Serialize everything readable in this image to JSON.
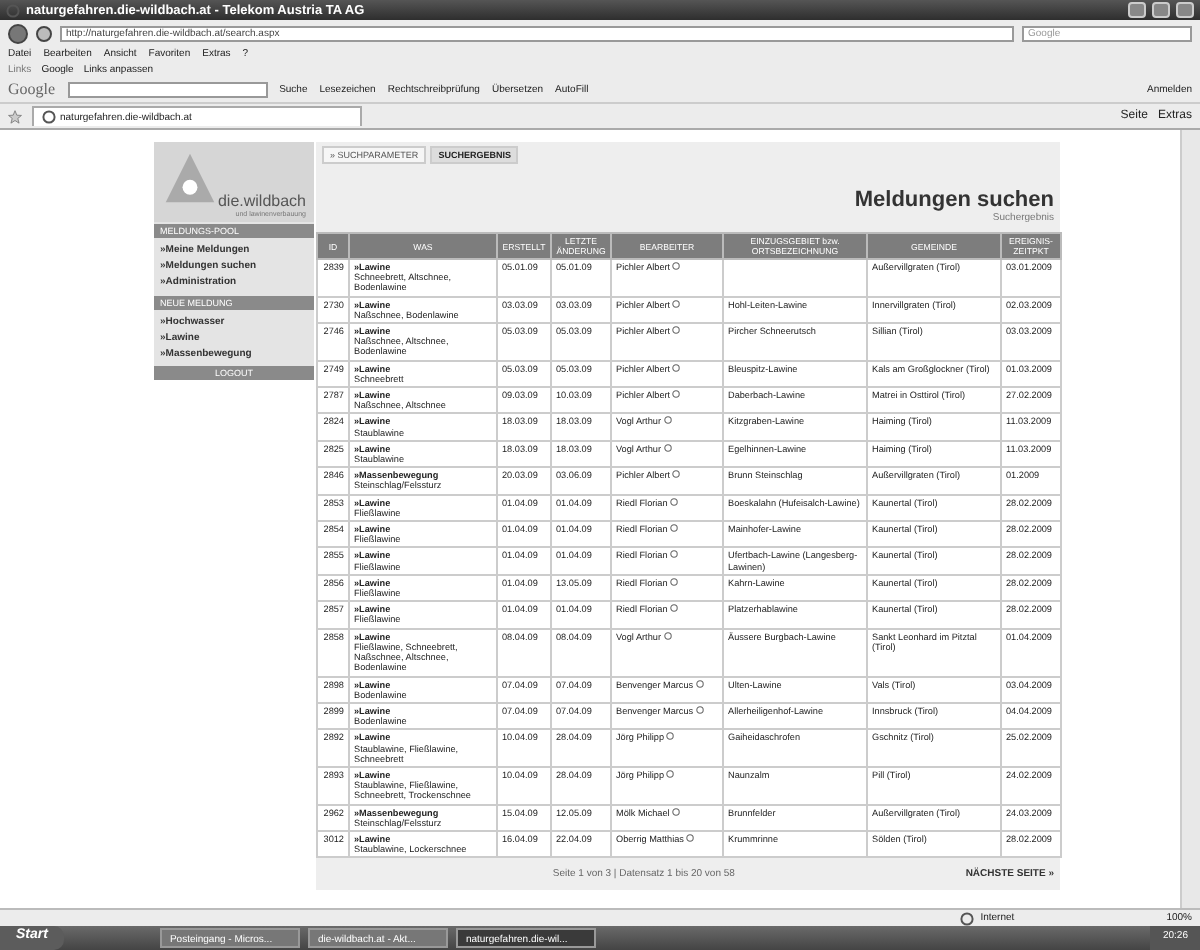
{
  "browser": {
    "title": "naturgefahren.die-wildbach.at - Telekom Austria TA AG",
    "address": "http://naturgefahren.die-wildbach.at/search.aspx",
    "search_placeholder": "Google",
    "menu": [
      "Datei",
      "Bearbeiten",
      "Ansicht",
      "Favoriten",
      "Extras",
      "?"
    ],
    "links_label": "Links",
    "links": [
      "Google",
      "Links anpassen"
    ],
    "google_toolbar": {
      "logo": "Google",
      "items": [
        "Suche",
        "Lesezeichen",
        "Rechtschreibprüfung",
        "Übersetzen",
        "AutoFill"
      ],
      "sign_in": "Anmelden"
    },
    "tab": {
      "title": "naturgefahren.die-wildbach.at"
    },
    "commands": [
      "Seite",
      "Extras"
    ]
  },
  "sidebar": {
    "logo": {
      "name": "die.wildbach",
      "tagline": "und lawinenverbauung"
    },
    "sections": [
      {
        "title": "MELDUNGS-POOL",
        "items": [
          "»Meine Meldungen",
          "»Meldungen suchen",
          "»Administration"
        ]
      },
      {
        "title": "NEUE MELDUNG",
        "items": [
          "»Hochwasser",
          "»Lawine",
          "»Massenbewegung"
        ]
      }
    ],
    "logout": "LOGOUT"
  },
  "page": {
    "tabs": [
      {
        "label": "» SUCHPARAMETER",
        "selected": false
      },
      {
        "label": "SUCHERGEBNIS",
        "selected": true
      }
    ],
    "title": "Meldungen suchen",
    "subtitle": "Suchergebnis",
    "table": {
      "columns": [
        "ID",
        "WAS",
        "ERSTELLT",
        "LETZTE ÄNDERUNG",
        "BEARBEITER",
        "EINZUGSGEBIET bzw. ORTSBEZEICHNUNG",
        "GEMEINDE",
        "EREIGNIS-ZEITPKT"
      ],
      "rows": [
        {
          "id": "2839",
          "category": "»Lawine",
          "types": "Schneebrett, Altschnee, Bodenlawine",
          "created": "05.01.09",
          "modified": "05.01.09",
          "editor": "Pichler Albert",
          "area": "",
          "municipality": "Außervillgraten (Tirol)",
          "event_date": "03.01.2009"
        },
        {
          "id": "2730",
          "category": "»Lawine",
          "types": "Naßschnee, Bodenlawine",
          "created": "03.03.09",
          "modified": "03.03.09",
          "editor": "Pichler Albert",
          "area": "Hohl-Leiten-Lawine",
          "municipality": "Innervillgraten (Tirol)",
          "event_date": "02.03.2009"
        },
        {
          "id": "2746",
          "category": "»Lawine",
          "types": "Naßschnee, Altschnee, Bodenlawine",
          "created": "05.03.09",
          "modified": "05.03.09",
          "editor": "Pichler Albert",
          "area": "Pircher Schneerutsch",
          "municipality": "Sillian (Tirol)",
          "event_date": "03.03.2009"
        },
        {
          "id": "2749",
          "category": "»Lawine",
          "types": "Schneebrett",
          "created": "05.03.09",
          "modified": "05.03.09",
          "editor": "Pichler Albert",
          "area": "Bleuspitz-Lawine",
          "municipality": "Kals am Großglockner (Tirol)",
          "event_date": "01.03.2009"
        },
        {
          "id": "2787",
          "category": "»Lawine",
          "types": "Naßschnee, Altschnee",
          "created": "09.03.09",
          "modified": "10.03.09",
          "editor": "Pichler Albert",
          "area": "Daberbach-Lawine",
          "municipality": "Matrei in Osttirol (Tirol)",
          "event_date": "27.02.2009"
        },
        {
          "id": "2824",
          "category": "»Lawine",
          "types": "Staublawine",
          "created": "18.03.09",
          "modified": "18.03.09",
          "editor": "Vogl Arthur",
          "area": "Kitzgraben-Lawine",
          "municipality": "Haiming (Tirol)",
          "event_date": "11.03.2009"
        },
        {
          "id": "2825",
          "category": "»Lawine",
          "types": "Staublawine",
          "created": "18.03.09",
          "modified": "18.03.09",
          "editor": "Vogl Arthur",
          "area": "Egelhinnen-Lawine",
          "municipality": "Haiming (Tirol)",
          "event_date": "11.03.2009"
        },
        {
          "id": "2846",
          "category": "»Massenbewegung",
          "types": "Steinschlag/Felssturz",
          "created": "20.03.09",
          "modified": "03.06.09",
          "editor": "Pichler Albert",
          "area": "Brunn Steinschlag",
          "municipality": "Außervillgraten (Tirol)",
          "event_date": "01.2009"
        },
        {
          "id": "2853",
          "category": "»Lawine",
          "types": "Fließlawine",
          "created": "01.04.09",
          "modified": "01.04.09",
          "editor": "Riedl Florian",
          "area": "Boeskalahn (Hufeisalch-Lawine)",
          "municipality": "Kaunertal (Tirol)",
          "event_date": "28.02.2009"
        },
        {
          "id": "2854",
          "category": "»Lawine",
          "types": "Fließlawine",
          "created": "01.04.09",
          "modified": "01.04.09",
          "editor": "Riedl Florian",
          "area": "Mainhofer-Lawine",
          "municipality": "Kaunertal (Tirol)",
          "event_date": "28.02.2009"
        },
        {
          "id": "2855",
          "category": "»Lawine",
          "types": "Fließlawine",
          "created": "01.04.09",
          "modified": "01.04.09",
          "editor": "Riedl Florian",
          "area": "Ufertbach-Lawine (Langesberg-Lawinen)",
          "municipality": "Kaunertal (Tirol)",
          "event_date": "28.02.2009"
        },
        {
          "id": "2856",
          "category": "»Lawine",
          "types": "Fließlawine",
          "created": "01.04.09",
          "modified": "13.05.09",
          "editor": "Riedl Florian",
          "area": "Kahrn-Lawine",
          "municipality": "Kaunertal (Tirol)",
          "event_date": "28.02.2009"
        },
        {
          "id": "2857",
          "category": "»Lawine",
          "types": "Fließlawine",
          "created": "01.04.09",
          "modified": "01.04.09",
          "editor": "Riedl Florian",
          "area": "Platzerhablawine",
          "municipality": "Kaunertal (Tirol)",
          "event_date": "28.02.2009"
        },
        {
          "id": "2858",
          "category": "»Lawine",
          "types": "Fließlawine, Schneebrett, Naßschnee, Altschnee, Bodenlawine",
          "created": "08.04.09",
          "modified": "08.04.09",
          "editor": "Vogl Arthur",
          "area": "Äussere Burgbach-Lawine",
          "municipality": "Sankt Leonhard im Pitztal (Tirol)",
          "event_date": "01.04.2009"
        },
        {
          "id": "2898",
          "category": "»Lawine",
          "types": "Bodenlawine",
          "created": "07.04.09",
          "modified": "07.04.09",
          "editor": "Benvenger Marcus",
          "area": "Ulten-Lawine",
          "municipality": "Vals (Tirol)",
          "event_date": "03.04.2009"
        },
        {
          "id": "2899",
          "category": "»Lawine",
          "types": "Bodenlawine",
          "created": "07.04.09",
          "modified": "07.04.09",
          "editor": "Benvenger Marcus",
          "area": "Allerheiligenhof-Lawine",
          "municipality": "Innsbruck (Tirol)",
          "event_date": "04.04.2009"
        },
        {
          "id": "2892",
          "category": "»Lawine",
          "types": "Staublawine, Fließlawine, Schneebrett",
          "created": "10.04.09",
          "modified": "28.04.09",
          "editor": "Jörg Philipp",
          "area": "Gaiheidaschrofen",
          "municipality": "Gschnitz (Tirol)",
          "event_date": "25.02.2009"
        },
        {
          "id": "2893",
          "category": "»Lawine",
          "types": "Staublawine, Fließlawine, Schneebrett, Trockenschnee",
          "created": "10.04.09",
          "modified": "28.04.09",
          "editor": "Jörg Philipp",
          "area": "Naunzalm",
          "municipality": "Pill (Tirol)",
          "event_date": "24.02.2009"
        },
        {
          "id": "2962",
          "category": "»Massenbewegung",
          "types": "Steinschlag/Felssturz",
          "created": "15.04.09",
          "modified": "12.05.09",
          "editor": "Mölk Michael",
          "area": "Brunnfelder",
          "municipality": "Außervillgraten (Tirol)",
          "event_date": "24.03.2009"
        },
        {
          "id": "3012",
          "category": "»Lawine",
          "types": "Staublawine, Lockerschnee",
          "created": "16.04.09",
          "modified": "22.04.09",
          "editor": "Oberrig Matthias",
          "area": "Krummrinne",
          "municipality": "Sölden (Tirol)",
          "event_date": "28.02.2009"
        }
      ]
    },
    "pager": {
      "info": "Seite 1 von 3 | Datensatz 1 bis 20 von 58",
      "next": "NÄCHSTE SEITE »"
    }
  },
  "status_bar": {
    "zone": "Internet",
    "zoom": "100%"
  },
  "taskbar": {
    "start": "Start",
    "tasks": [
      {
        "label": "Posteingang - Micros...",
        "selected": false
      },
      {
        "label": "die-wildbach.at - Akt...",
        "selected": false
      },
      {
        "label": "naturgefahren.die-wil...",
        "selected": true
      }
    ],
    "clock": "20:26"
  }
}
